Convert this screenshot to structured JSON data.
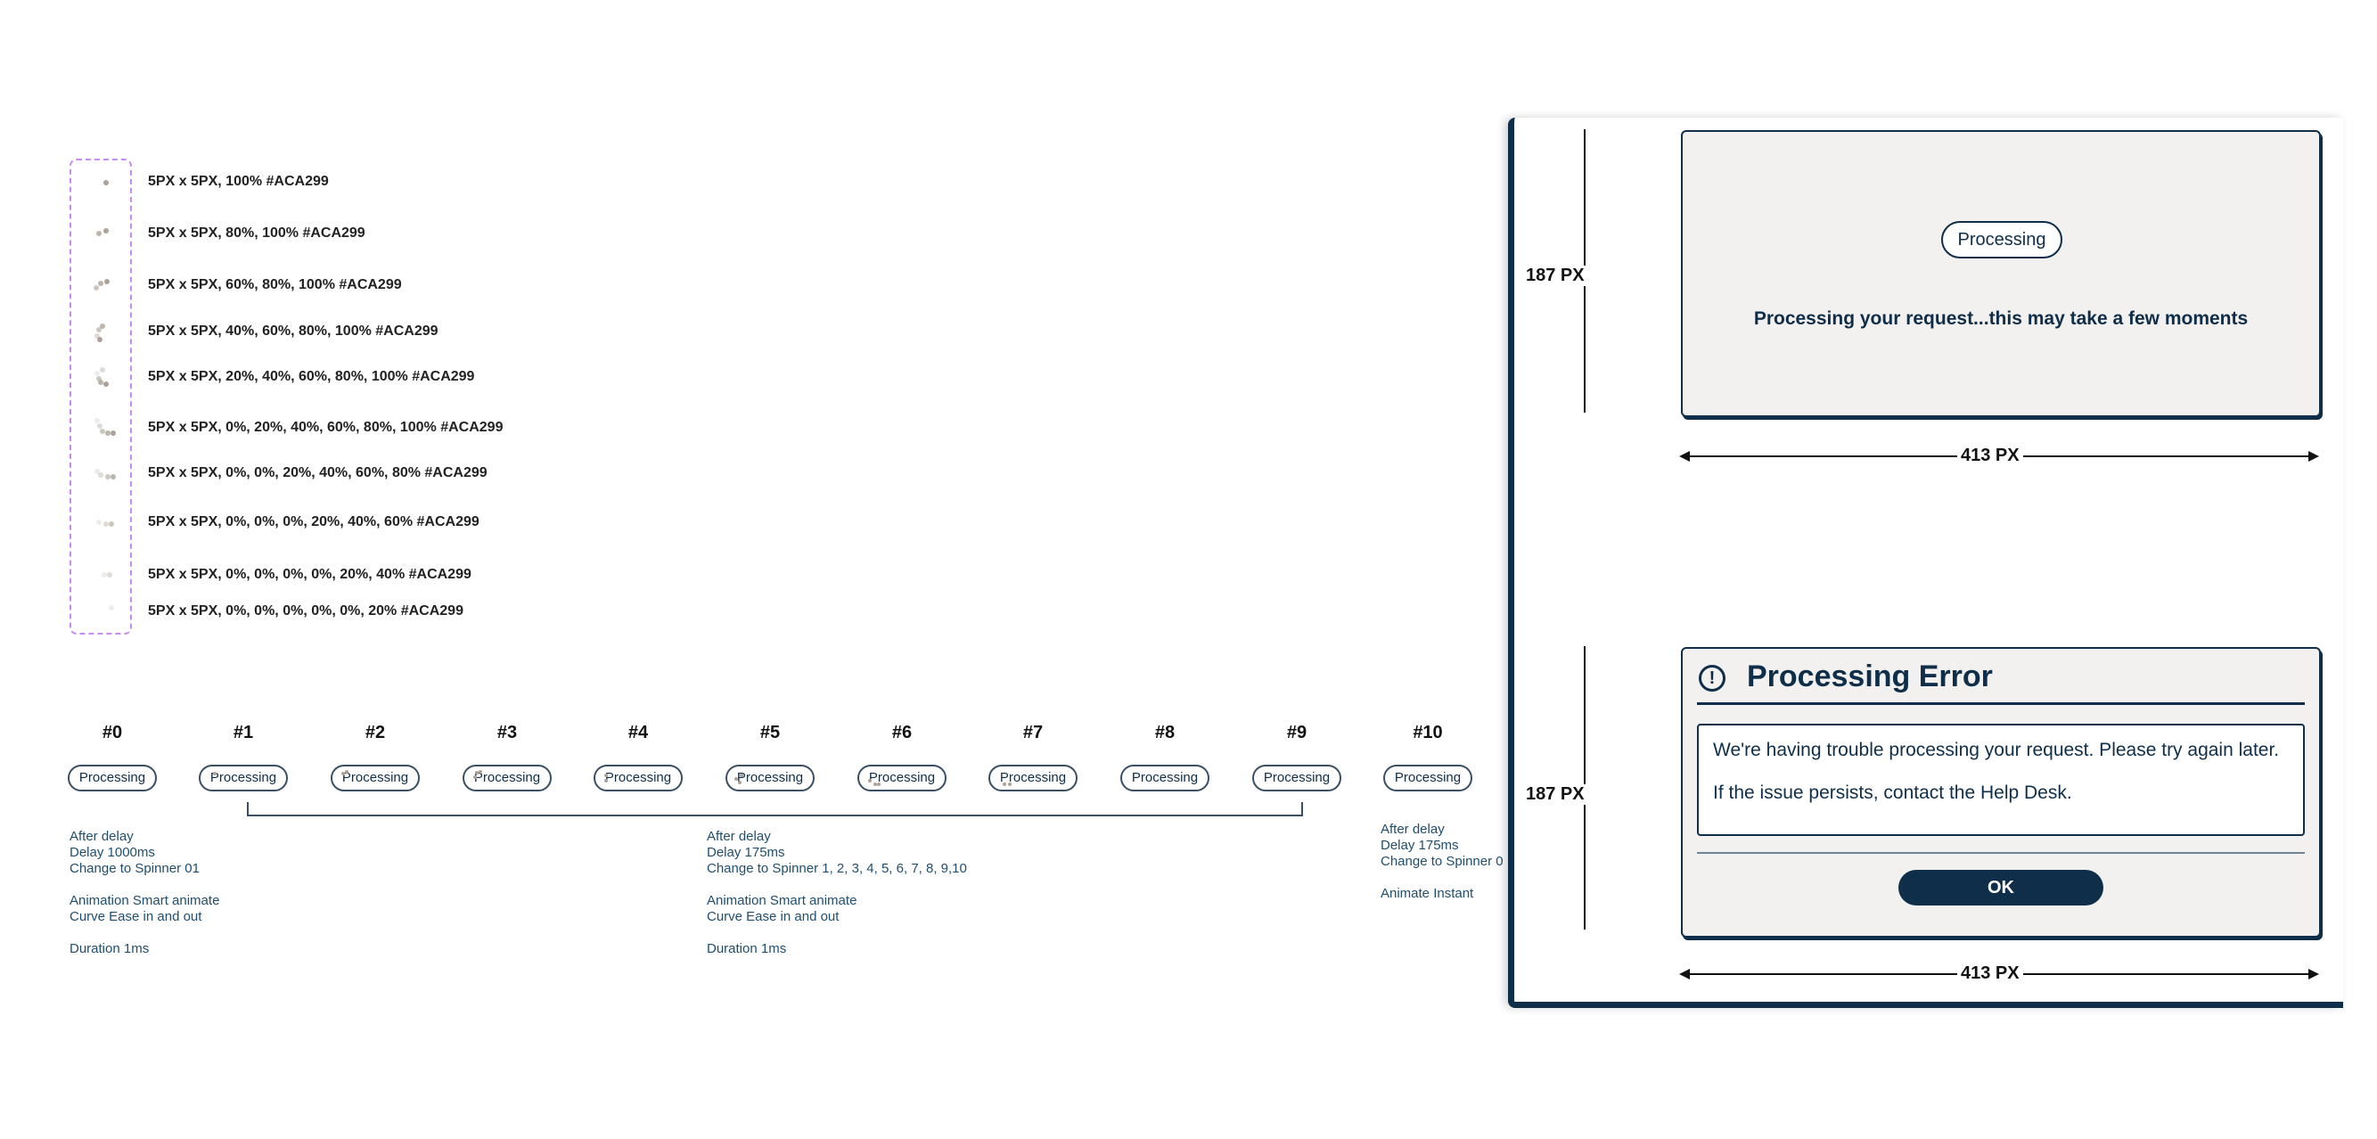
{
  "legend": {
    "rows": [
      {
        "label": "5PX x 5PX, 100% #ACA299"
      },
      {
        "label": "5PX x 5PX, 80%, 100% #ACA299"
      },
      {
        "label": "5PX x 5PX, 60%, 80%, 100% #ACA299"
      },
      {
        "label": "5PX x 5PX, 40%, 60%, 80%, 100% #ACA299"
      },
      {
        "label": "5PX x 5PX, 20%, 40%, 60%, 80%, 100% #ACA299"
      },
      {
        "label": "5PX x 5PX, 0%, 20%, 40%, 60%, 80%, 100% #ACA299"
      },
      {
        "label": "5PX x 5PX, 0%, 0%, 20%, 40%, 60%, 80% #ACA299"
      },
      {
        "label": "5PX x 5PX, 0%, 0%, 0%, 20%, 40%, 60% #ACA299"
      },
      {
        "label": "5PX x 5PX, 0%, 0%, 0%, 0%, 20%, 40% #ACA299"
      },
      {
        "label": "5PX x 5PX, 0%, 0%, 0%, 0%, 0%, 20% #ACA299"
      }
    ],
    "dot_color": "#ACA299"
  },
  "frames": [
    {
      "num": "#0",
      "label": "Processing"
    },
    {
      "num": "#1",
      "label": "Processing"
    },
    {
      "num": "#2",
      "label": "Processing"
    },
    {
      "num": "#3",
      "label": "Processing"
    },
    {
      "num": "#4",
      "label": "Processing"
    },
    {
      "num": "#5",
      "label": "Processing"
    },
    {
      "num": "#6",
      "label": "Processing"
    },
    {
      "num": "#7",
      "label": "Processing"
    },
    {
      "num": "#8",
      "label": "Processing"
    },
    {
      "num": "#9",
      "label": "Processing"
    },
    {
      "num": "#10",
      "label": "Processing"
    }
  ],
  "notes": {
    "first": "After delay\nDelay 1000ms\nChange to Spinner 01\n\nAnimation Smart animate\nCurve Ease in and out\n\nDuration 1ms",
    "middle": "After delay\nDelay 175ms\nChange to Spinner 1, 2, 3, 4, 5, 6, 7, 8, 9,10\n\nAnimation Smart animate\nCurve Ease in and out\n\nDuration 1ms",
    "last": "After delay\nDelay 175ms\nChange to Spinner 0\n\nAnimate Instant"
  },
  "processing_dialog": {
    "pill_label": "Processing",
    "message": "Processing your request...this may take a few moments",
    "height_label": "187 PX",
    "width_label": "413 PX"
  },
  "error_dialog": {
    "icon": "!",
    "title": "Processing Error",
    "line1": "We're having trouble processing your request. Please try again later.",
    "line2": "If the issue persists, contact the Help Desk.",
    "ok_label": "OK",
    "height_label": "187 PX",
    "width_label": "413 PX"
  },
  "colors": {
    "navy": "#0F2E49",
    "dot": "#ACA299",
    "dashed_outline": "#C68CF2"
  }
}
